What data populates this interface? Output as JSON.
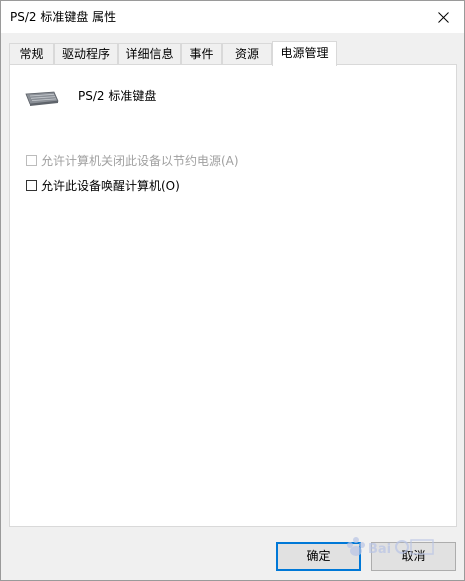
{
  "window": {
    "title": "PS/2 标准键盘 属性"
  },
  "tabs": [
    {
      "label": "常规"
    },
    {
      "label": "驱动程序"
    },
    {
      "label": "详细信息"
    },
    {
      "label": "事件"
    },
    {
      "label": "资源"
    },
    {
      "label": "电源管理",
      "active": true
    }
  ],
  "device": {
    "name": "PS/2 标准键盘",
    "icon": "keyboard-icon"
  },
  "options": [
    {
      "label": "允许计算机关闭此设备以节约电源(A)",
      "enabled": false,
      "checked": false
    },
    {
      "label": "允许此设备唤醒计算机(O)",
      "enabled": true,
      "checked": false
    }
  ],
  "buttons": {
    "ok": "确定",
    "cancel": "取消"
  },
  "colors": {
    "accent": "#0078d7",
    "disabled_text": "#a0a0a0"
  }
}
